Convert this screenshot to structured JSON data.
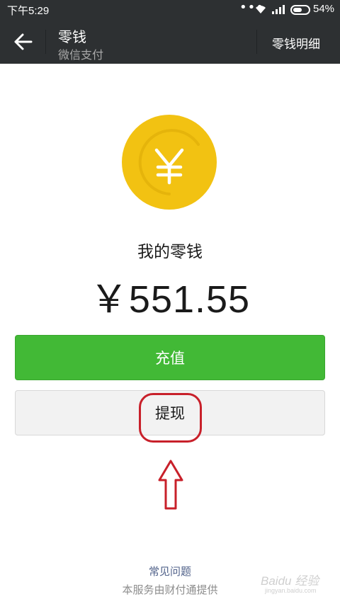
{
  "status_bar": {
    "time": "下午5:29",
    "dots": "•••",
    "battery_percent": "54%"
  },
  "title_bar": {
    "title": "零钱",
    "subtitle": "微信支付",
    "detail_link": "零钱明细"
  },
  "balance": {
    "label": "我的零钱",
    "amount": "￥551.55"
  },
  "buttons": {
    "recharge": "充值",
    "withdraw": "提现"
  },
  "footer": {
    "faq": "常见问题",
    "provider": "本服务由财付通提供"
  },
  "watermark": {
    "brand": "Baidu 经验",
    "url": "jingyan.baidu.com"
  },
  "colors": {
    "header_bg": "#2d3032",
    "coin": "#f2c212",
    "primary_button": "#42b936",
    "annotation": "#c8202a",
    "link": "#51628a"
  },
  "icons": {
    "back": "arrow-left-icon",
    "coin": "yuan-coin-icon",
    "annotation_arrow": "up-arrow-icon"
  }
}
